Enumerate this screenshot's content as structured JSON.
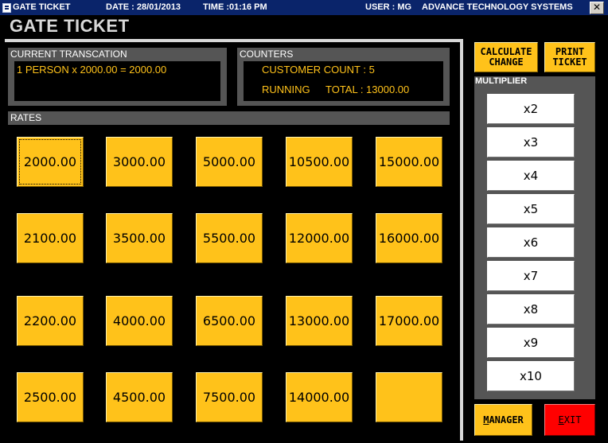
{
  "titlebar": {
    "app_title": "GATE TICKET",
    "date": "DATE : 28/01/2013",
    "time": "TIME :01:16 PM",
    "user": "USER : MG",
    "company": "ADVANCE TECHNOLOGY  SYSTEMS",
    "close_glyph": "✕"
  },
  "heading": "GATE TICKET",
  "current_transaction": {
    "label": "CURRENT TRANSCATION",
    "line": "1 PERSON x 2000.00 = 2000.00"
  },
  "counters": {
    "label": "COUNTERS",
    "customer_count": "CUSTOMER COUNT : 5",
    "running_label": "RUNNING",
    "total": "TOTAL : 13000.00"
  },
  "rates": {
    "label": "RATES",
    "rows": [
      [
        "2000.00",
        "3000.00",
        "5000.00",
        "10500.00",
        "15000.00"
      ],
      [
        "2100.00",
        "3500.00",
        "5500.00",
        "12000.00",
        "16000.00"
      ],
      [
        "2200.00",
        "4000.00",
        "6500.00",
        "13000.00",
        "17000.00"
      ],
      [
        "2500.00",
        "4500.00",
        "7500.00",
        "14000.00",
        ""
      ]
    ],
    "selected": "2000.00"
  },
  "actions": {
    "calculate_line1": "CALCULATE",
    "calculate_line2": "CHANGE",
    "print_line1": "PRINT",
    "print_line2": "TICKET"
  },
  "multiplier": {
    "label": "MULTIPLIER",
    "options": [
      "x2",
      "x3",
      "x4",
      "x5",
      "x6",
      "x7",
      "x8",
      "x9",
      "x10"
    ]
  },
  "footer": {
    "manager_first": "M",
    "manager_rest": "ANAGER",
    "exit_first": "E",
    "exit_rest": "XIT"
  },
  "colors": {
    "accent_yellow": "#ffc21a",
    "exit_red": "#ff0000",
    "titlebar_blue": "#0a246a"
  }
}
